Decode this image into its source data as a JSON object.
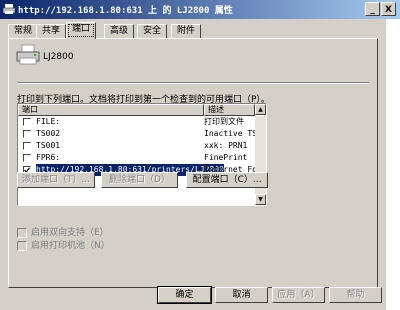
{
  "window": {
    "title": "http://192.168.1.80:631 上 的 LJ2800 属性",
    "min_label": "_",
    "close_label": "X"
  },
  "tabs": [
    {
      "label": "常规"
    },
    {
      "label": "共享"
    },
    {
      "label": "端口"
    },
    {
      "label": "高级"
    },
    {
      "label": "安全"
    },
    {
      "label": "附件"
    }
  ],
  "printer": {
    "name": "LJ2800"
  },
  "instruction": "打印到下列端口。文档将打印到第一个检查到的可用端口（P）。",
  "port_table": {
    "col_port": "端口",
    "col_desc": "描述",
    "rows": [
      {
        "port": "FILE:",
        "desc": "打印到文件",
        "checked": false
      },
      {
        "port": "TS002",
        "desc": "Inactive TS",
        "checked": false
      },
      {
        "port": "TS001",
        "desc": "xxk: PRN1",
        "checked": false
      },
      {
        "port": "FPR6:",
        "desc": "FinePrint",
        "checked": false
      },
      {
        "port": "http://192.168.1.80:631/printers/LJ2800",
        "desc": "Internet Fo",
        "checked": true
      }
    ]
  },
  "port_buttons": {
    "add": "添加端口（T）...",
    "delete": "删除端口（D）",
    "configure": "配置端口（C）..."
  },
  "options": {
    "bidi": "启用双向支持（E）",
    "pool": "启用打印机池（N）"
  },
  "footer": {
    "ok": "确定",
    "cancel": "取消",
    "apply": "应用（A）",
    "help": "帮助"
  },
  "colors": {
    "titlebar_start": "#0a246a",
    "titlebar_end": "#a6caf0",
    "dialog_bg": "#d4d0c8",
    "selection": "#0a246a"
  }
}
